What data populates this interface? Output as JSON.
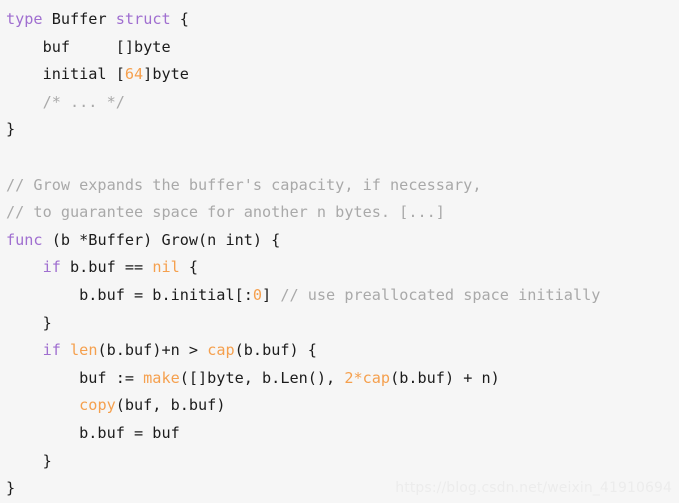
{
  "document": {
    "kind": "code-snippet",
    "language": "go",
    "background_color": "#f6f6f6",
    "colors": {
      "keyword": "#a06fd0",
      "builtin": "#f5a04e",
      "number": "#f5a04e",
      "comment": "#a9a9a9",
      "plain": "#1c1c1c",
      "watermark": "#ececec"
    }
  },
  "watermark": {
    "text": "https://blog.csdn.net/weixin_41910694"
  },
  "code": {
    "lines": [
      {
        "index": 1,
        "text": "type Buffer struct {",
        "tokens": [
          {
            "t": "type",
            "c": "kw"
          },
          {
            "t": " ",
            "c": "plain"
          },
          {
            "t": "Buffer",
            "c": "plain"
          },
          {
            "t": " ",
            "c": "plain"
          },
          {
            "t": "struct",
            "c": "kw"
          },
          {
            "t": " {",
            "c": "plain"
          }
        ]
      },
      {
        "index": 2,
        "text": "    buf     []byte",
        "tokens": [
          {
            "t": "    buf     []byte",
            "c": "plain"
          }
        ]
      },
      {
        "index": 3,
        "text": "    initial [64]byte",
        "tokens": [
          {
            "t": "    initial [",
            "c": "plain"
          },
          {
            "t": "64",
            "c": "num"
          },
          {
            "t": "]byte",
            "c": "plain"
          }
        ]
      },
      {
        "index": 4,
        "text": "    /* ... */",
        "tokens": [
          {
            "t": "    ",
            "c": "plain"
          },
          {
            "t": "/* ... */",
            "c": "comment"
          }
        ]
      },
      {
        "index": 5,
        "text": "}",
        "tokens": [
          {
            "t": "}",
            "c": "plain"
          }
        ]
      },
      {
        "index": 6,
        "text": "",
        "tokens": []
      },
      {
        "index": 7,
        "text": "// Grow expands the buffer's capacity, if necessary,",
        "tokens": [
          {
            "t": "// Grow expands the buffer's capacity, if necessary,",
            "c": "comment"
          }
        ]
      },
      {
        "index": 8,
        "text": "// to guarantee space for another n bytes. [...]",
        "tokens": [
          {
            "t": "// to guarantee space for another n bytes. [...]",
            "c": "comment"
          }
        ]
      },
      {
        "index": 9,
        "text": "func (b *Buffer) Grow(n int) {",
        "tokens": [
          {
            "t": "func",
            "c": "kw"
          },
          {
            "t": " (b *Buffer) Grow(n int) {",
            "c": "plain"
          }
        ]
      },
      {
        "index": 10,
        "text": "    if b.buf == nil {",
        "tokens": [
          {
            "t": "    ",
            "c": "plain"
          },
          {
            "t": "if",
            "c": "kw"
          },
          {
            "t": " b.buf == ",
            "c": "plain"
          },
          {
            "t": "nil",
            "c": "builtin"
          },
          {
            "t": " {",
            "c": "plain"
          }
        ]
      },
      {
        "index": 11,
        "text": "        b.buf = b.initial[:0] // use preallocated space initially",
        "tokens": [
          {
            "t": "        b.buf = b.initial[:",
            "c": "plain"
          },
          {
            "t": "0",
            "c": "num"
          },
          {
            "t": "] ",
            "c": "plain"
          },
          {
            "t": "// use preallocated space initially",
            "c": "comment"
          }
        ]
      },
      {
        "index": 12,
        "text": "    }",
        "tokens": [
          {
            "t": "    }",
            "c": "plain"
          }
        ]
      },
      {
        "index": 13,
        "text": "    if len(b.buf)+n > cap(b.buf) {",
        "tokens": [
          {
            "t": "    ",
            "c": "plain"
          },
          {
            "t": "if",
            "c": "kw"
          },
          {
            "t": " ",
            "c": "plain"
          },
          {
            "t": "len",
            "c": "builtin"
          },
          {
            "t": "(b.buf)+n > ",
            "c": "plain"
          },
          {
            "t": "cap",
            "c": "builtin"
          },
          {
            "t": "(b.buf) {",
            "c": "plain"
          }
        ]
      },
      {
        "index": 14,
        "text": "        buf := make([]byte, b.Len(), 2*cap(b.buf) + n)",
        "tokens": [
          {
            "t": "        buf := ",
            "c": "plain"
          },
          {
            "t": "make",
            "c": "builtin"
          },
          {
            "t": "([]byte, b.Len(), ",
            "c": "plain"
          },
          {
            "t": "2",
            "c": "num"
          },
          {
            "t": "*",
            "c": "builtin"
          },
          {
            "t": "cap",
            "c": "builtin"
          },
          {
            "t": "(b.buf) + n)",
            "c": "plain"
          }
        ]
      },
      {
        "index": 15,
        "text": "        copy(buf, b.buf)",
        "tokens": [
          {
            "t": "        ",
            "c": "plain"
          },
          {
            "t": "copy",
            "c": "builtin"
          },
          {
            "t": "(buf, b.buf)",
            "c": "plain"
          }
        ]
      },
      {
        "index": 16,
        "text": "        b.buf = buf",
        "tokens": [
          {
            "t": "        b.buf = buf",
            "c": "plain"
          }
        ]
      },
      {
        "index": 17,
        "text": "    }",
        "tokens": [
          {
            "t": "    }",
            "c": "plain"
          }
        ]
      },
      {
        "index": 18,
        "text": "}",
        "tokens": [
          {
            "t": "}",
            "c": "plain"
          }
        ]
      }
    ]
  }
}
